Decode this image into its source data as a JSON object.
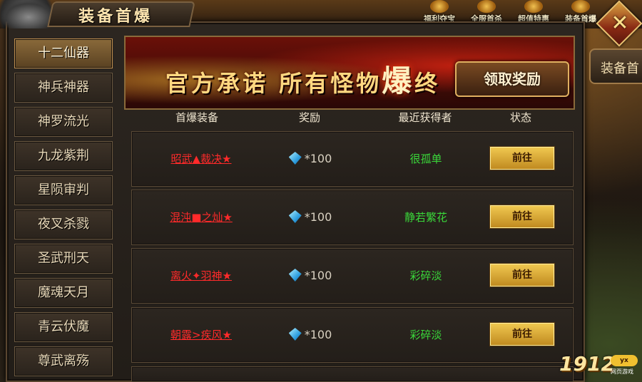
{
  "window": {
    "title": "装备首爆"
  },
  "top_bar": {
    "icons": [
      {
        "label": "福利夺宝",
        "icon": "treasure-icon"
      },
      {
        "label": "全服首杀",
        "icon": "skull-icon"
      },
      {
        "label": "超值特惠",
        "icon": "gift-icon"
      },
      {
        "label": "装备首爆",
        "icon": "gear-icon"
      }
    ]
  },
  "side_tab": {
    "label": "装备首"
  },
  "menu": {
    "items": [
      {
        "label": "十二仙器",
        "active": true
      },
      {
        "label": "神兵神器"
      },
      {
        "label": "神罗流光"
      },
      {
        "label": "九龙紫荆"
      },
      {
        "label": "星陨审判"
      },
      {
        "label": "夜叉杀戮"
      },
      {
        "label": "圣武刑天"
      },
      {
        "label": "魔魂天月"
      },
      {
        "label": "青云伏魔"
      },
      {
        "label": "尊武离殇"
      }
    ]
  },
  "banner": {
    "text_before": "官方承诺 所有怪物",
    "text_emph": "爆",
    "text_after": "终",
    "claim_label": "领取奖励"
  },
  "table": {
    "headers": [
      "首爆装备",
      "奖励",
      "最近获得者",
      "状态"
    ],
    "rows": [
      {
        "item": "昭武▲裁决★",
        "reward": "*100",
        "winner": "很孤单",
        "action": "前往"
      },
      {
        "item": "混沌■之灿★",
        "reward": "*100",
        "winner": "静若繁花",
        "action": "前往"
      },
      {
        "item": "离火✦羽神★",
        "reward": "*100",
        "winner": "彩碎淡",
        "action": "前往"
      },
      {
        "item": "朝露>疾风★",
        "reward": "*100",
        "winner": "彩碎淡",
        "action": "前往"
      }
    ]
  },
  "logo": {
    "number": "1912",
    "badge": "yx",
    "sub": "网页游戏"
  },
  "colors": {
    "item_link": "#ff2a2a",
    "winner": "#3ad83a",
    "button_gold": "#f0c850"
  }
}
